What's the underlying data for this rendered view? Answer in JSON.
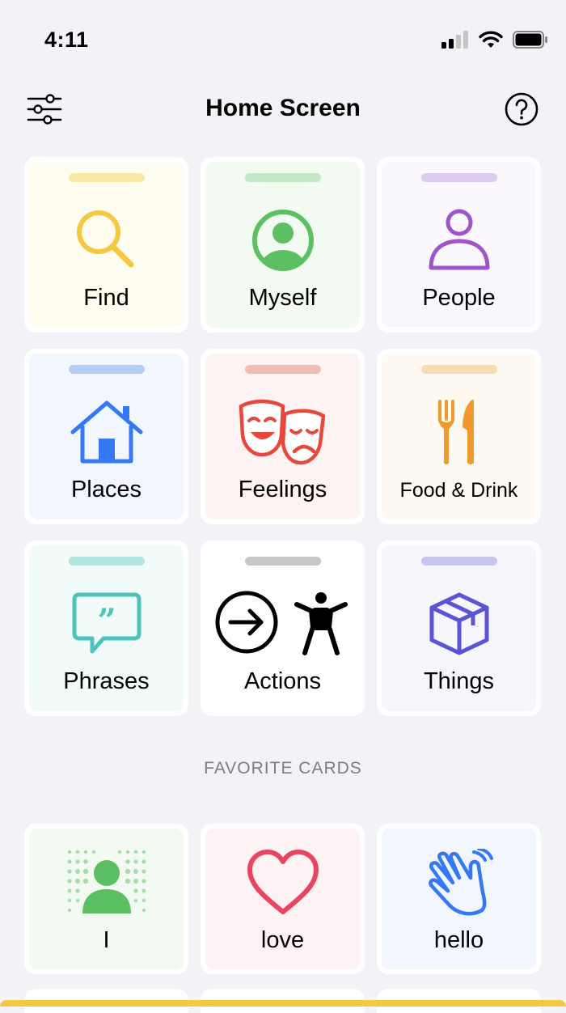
{
  "status": {
    "time": "4:11"
  },
  "header": {
    "title": "Home Screen"
  },
  "categories": [
    {
      "label": "Find",
      "icon": "search-icon",
      "tab_color": "#f7e9a4",
      "bg": "#fffdf0"
    },
    {
      "label": "Myself",
      "icon": "person-circle-icon",
      "tab_color": "#c3e8c6",
      "bg": "#f2faf2"
    },
    {
      "label": "People",
      "icon": "person-icon",
      "tab_color": "#dccbf0",
      "bg": "#faf7fd"
    },
    {
      "label": "Places",
      "icon": "house-icon",
      "tab_color": "#b3cdf5",
      "bg": "#f1f6ff"
    },
    {
      "label": "Feelings",
      "icon": "theater-masks-icon",
      "tab_color": "#f2bcb6",
      "bg": "#fdf3f2"
    },
    {
      "label": "Food & Drink",
      "icon": "fork-knife-icon",
      "tab_color": "#f6dcae",
      "bg": "#fffaf1"
    },
    {
      "label": "Phrases",
      "icon": "quote-bubble-icon",
      "tab_color": "#b2e4e0",
      "bg": "#f1fbfa"
    },
    {
      "label": "Actions",
      "icon": "arrow-person-icon",
      "tab_color": "#c8c8c8",
      "bg": "#ffffff"
    },
    {
      "label": "Things",
      "icon": "cube-icon",
      "tab_color": "#c9c6ee",
      "bg": "#f7f6fd"
    }
  ],
  "favorites_title": "FAVORITE CARDS",
  "favorites": [
    {
      "label": "I",
      "icon": "person-speaking-icon",
      "bg": "#f2faf2"
    },
    {
      "label": "love",
      "icon": "heart-icon",
      "bg": "#fef3f4"
    },
    {
      "label": "hello",
      "icon": "waving-hand-icon",
      "bg": "#f1f6ff"
    }
  ]
}
